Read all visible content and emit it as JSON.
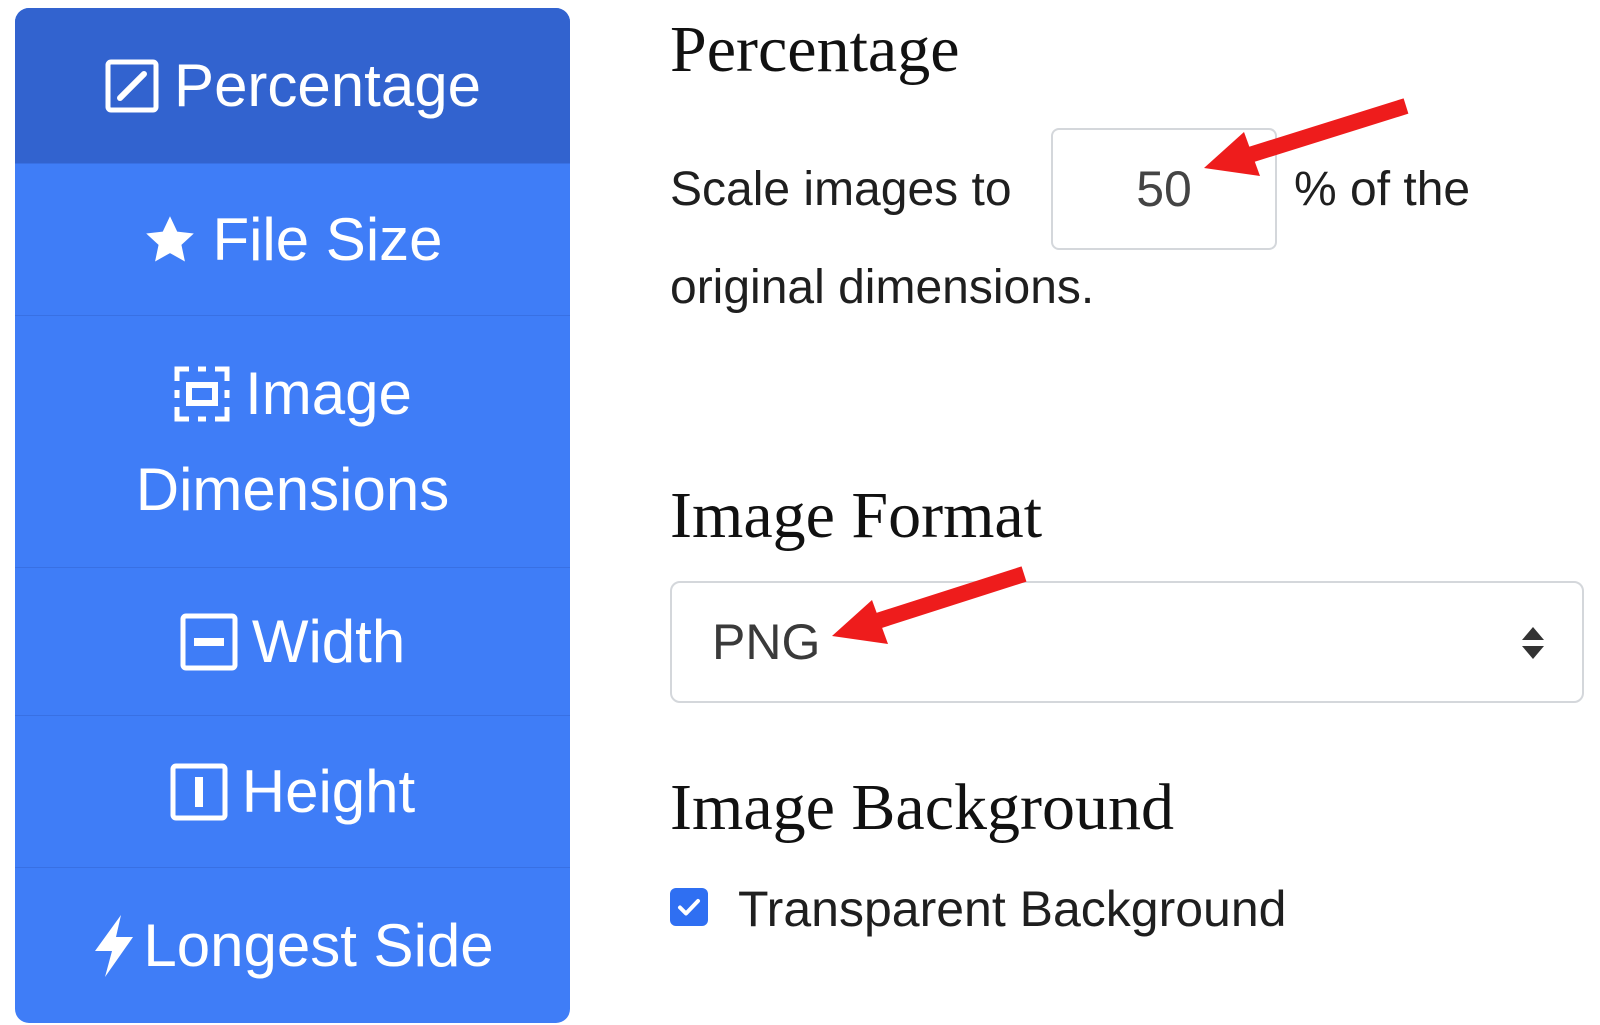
{
  "sidebar": {
    "items": [
      {
        "label": "Percentage",
        "icon": "pencil-square-icon",
        "active": true
      },
      {
        "label": "File Size",
        "icon": "star-icon",
        "active": false
      },
      {
        "label_line1": "Image",
        "label_line2": "Dimensions",
        "icon": "resize-frame-icon",
        "active": false
      },
      {
        "label": "Width",
        "icon": "minus-square-icon",
        "active": false
      },
      {
        "label": "Height",
        "icon": "vertical-bar-square-icon",
        "active": false
      },
      {
        "label": "Longest Side",
        "icon": "lightning-icon",
        "active": false
      }
    ],
    "colors": {
      "background": "#3f7df7",
      "active": "#3263cf",
      "text": "#ffffff"
    }
  },
  "percentage_section": {
    "title": "Percentage",
    "prefix": "Scale images to",
    "value": "50",
    "suffix": "% of the",
    "line2": "original dimensions."
  },
  "format_section": {
    "title": "Image Format",
    "selected": "PNG"
  },
  "background_section": {
    "title": "Image Background",
    "checkbox_label": "Transparent Background",
    "checked": true
  },
  "annotations": {
    "arrow_color": "#ee1c1c"
  }
}
